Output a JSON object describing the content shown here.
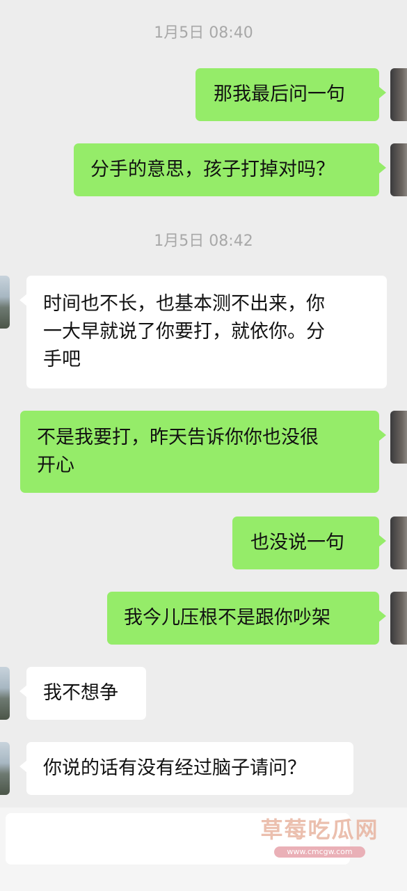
{
  "chat": {
    "timestamps": [
      "1月5日 08:40",
      "1月5日 08:42"
    ],
    "messages": [
      {
        "side": "me",
        "text": "那我最后问一句"
      },
      {
        "side": "me",
        "text": "分手的意思，孩子打掉对吗？"
      },
      {
        "side": "them",
        "text": "时间也不长，也基本测不出来，你\n一大早就说了你要打，就依你。分\n手吧"
      },
      {
        "side": "me",
        "text": "不是我要打，昨天告诉你你也没很\n开心"
      },
      {
        "side": "me",
        "text": "也没说一句"
      },
      {
        "side": "me",
        "text": "我今儿压根不是跟你吵架"
      },
      {
        "side": "them",
        "text": "我不想争"
      },
      {
        "side": "them",
        "text": "你说的话有没有经过脑子请问？"
      }
    ]
  },
  "watermark": {
    "title": "草莓吃瓜网",
    "url": "www.cmcgw.com"
  },
  "colors": {
    "background": "#ededed",
    "my_bubble": "#95ec69",
    "their_bubble": "#ffffff",
    "timestamp_text": "#a8a8a8"
  }
}
